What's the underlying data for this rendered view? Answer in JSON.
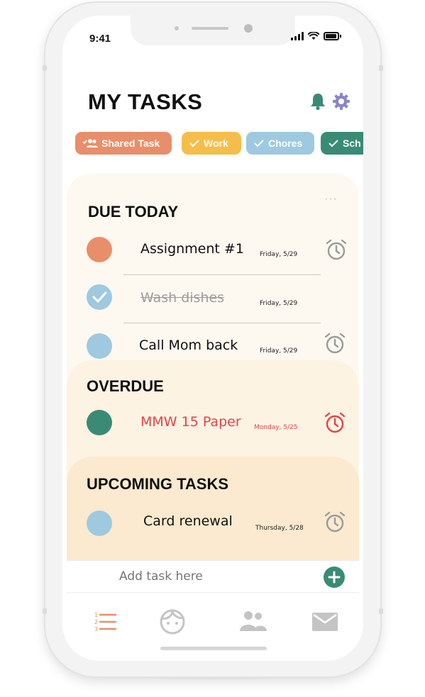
{
  "status": {
    "time": "9:41"
  },
  "header": {
    "title": "MY TASKS"
  },
  "chips": [
    {
      "label": "Shared Task",
      "color": "#e88e6a",
      "icon": "people-icon"
    },
    {
      "label": "Work",
      "color": "#f5be4a",
      "icon": "check-icon"
    },
    {
      "label": "Chores",
      "color": "#9ec9e0",
      "icon": "check-icon"
    },
    {
      "label": "Sch",
      "color": "#3a8b76",
      "icon": "check-icon"
    }
  ],
  "due_today": {
    "title": "DUE TODAY",
    "tasks": [
      {
        "name": "Assignment #1",
        "date": "Friday, 5/29",
        "color": "#e88e6a",
        "done": false,
        "alarm": true
      },
      {
        "name": "Wash dishes",
        "date": "Friday, 5/29",
        "color": "#9ec9e0",
        "done": true,
        "alarm": false
      },
      {
        "name": "Call Mom back",
        "date": "Friday, 5/29",
        "color": "#9ec9e0",
        "done": false,
        "alarm": true
      }
    ]
  },
  "overdue": {
    "title": "OVERDUE",
    "tasks": [
      {
        "name": "MMW 15 Paper",
        "date": "Monday, 5/25",
        "color": "#3a8b76",
        "alarm_color": "#e0454a"
      }
    ]
  },
  "upcoming": {
    "title": "UPCOMING TASKS",
    "tasks": [
      {
        "name": "Card renewal",
        "date": "Thursday, 5/28",
        "color": "#9ec9e0"
      }
    ]
  },
  "add_task": {
    "placeholder": "Add task here"
  },
  "nav": {
    "active": "list",
    "accent": "#e88e6a"
  }
}
